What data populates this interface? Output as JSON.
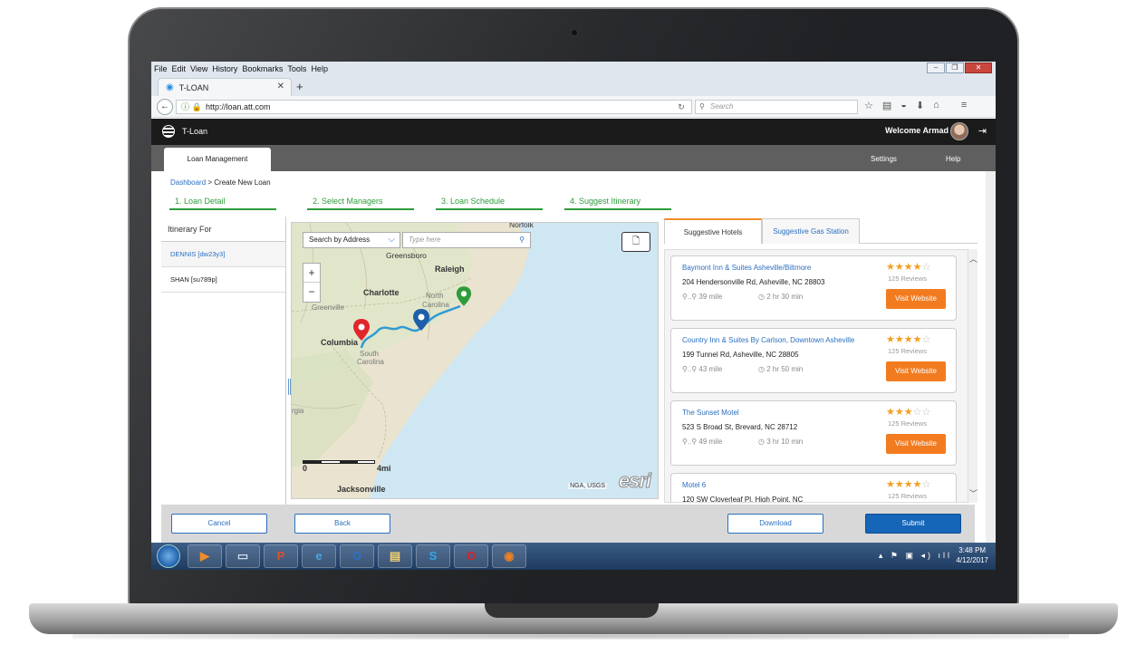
{
  "browser": {
    "menu": [
      "File",
      "Edit",
      "View",
      "History",
      "Bookmarks",
      "Tools",
      "Help"
    ],
    "tab_title": "T-LOAN",
    "new_tab": "+",
    "url": "http://loan.att.com",
    "search_placeholder": "Search"
  },
  "app": {
    "brand": "T-Loan",
    "welcome": "Welcome  Armad",
    "main_tab": "Loan Management",
    "settings": "Settings",
    "help": "Help"
  },
  "breadcrumb": {
    "link": "Dashboard",
    "separator": ">",
    "current": "Create New Loan"
  },
  "steps": [
    "1. Loan Detail",
    "2. Select Managers",
    "3. Loan Schedule",
    "4. Suggest Itinerary"
  ],
  "itinerary": {
    "header": "Itinerary For",
    "people": [
      "DENNIS [dw23y3]",
      "SHAN [su789p]"
    ]
  },
  "map": {
    "search_mode": "Search by Address",
    "search_placeholder": "Type here",
    "zoom_in": "+",
    "zoom_out": "−",
    "labels": {
      "norfolk": "Norfolk",
      "greensboro": "Greensboro",
      "raleigh": "Raleigh",
      "charlotte": "Charlotte",
      "north_carolina_1": "North",
      "north_carolina_2": "Carolina",
      "greenville": "Greenville",
      "columbia": "Columbia",
      "south_carolina_1": "South",
      "south_carolina_2": "Carolina",
      "georgia": "rgia",
      "jacksonville": "Jacksonville"
    },
    "scale_start": "0",
    "scale_end": "4mi",
    "attribution": "NGA, USGS",
    "logo": "esri"
  },
  "hotels_tabs": {
    "active": "Suggestive Hotels",
    "inactive": "Suggestive Gas Station"
  },
  "hotels": [
    {
      "name": "Baymont Inn & Suites Asheville/Biltmore",
      "address": "204 Hendersonville Rd, Asheville, NC 28803",
      "distance": "39 mile",
      "time": "2 hr 30 min",
      "rating": 4,
      "reviews": "125 Reviews",
      "button": "Visit Website"
    },
    {
      "name": "Country Inn & Suites By Carlson, Downtown Asheville",
      "address": "199 Tunnel Rd, Asheville, NC 28805",
      "distance": "43 mile",
      "time": "2 hr 50 min",
      "rating": 4,
      "reviews": "125 Reviews",
      "button": "Visit Website"
    },
    {
      "name": "The Sunset Motel",
      "address": "523 S Broad St, Brevard, NC 28712",
      "distance": "49 mile",
      "time": "3 hr 10 min",
      "rating": 3,
      "reviews": "125 Reviews",
      "button": "Visit Website"
    },
    {
      "name": "Motel 6",
      "address": "120 SW Cloverleaf Pl, High Point, NC",
      "distance": "",
      "time": "",
      "rating": 4,
      "reviews": "125 Reviews",
      "button": ""
    }
  ],
  "footer": {
    "cancel": "Cancel",
    "back": "Back",
    "download": "Download",
    "submit": "Submit"
  },
  "taskbar": {
    "time": "3:48 PM",
    "date": "4/12/2017"
  },
  "colors": {
    "accent_orange": "#f27b1f",
    "step_green": "#2e9c3a",
    "link_blue": "#2a6fc0",
    "primary_button": "#1565b8"
  }
}
